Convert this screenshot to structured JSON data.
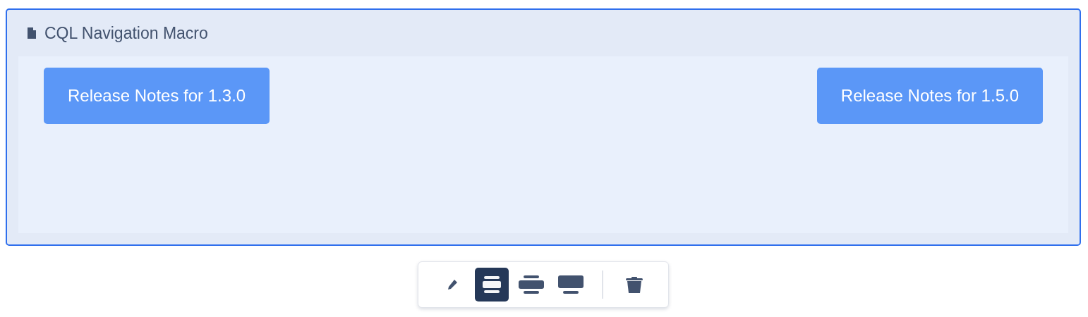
{
  "macro": {
    "title": "CQL Navigation Macro"
  },
  "buttons": [
    {
      "label": "Release Notes for 1.3.0"
    },
    {
      "label": "Release Notes for 1.5.0"
    }
  ],
  "toolbar": [
    {
      "kind": "edit"
    },
    {
      "kind": "narrow",
      "selected": true
    },
    {
      "kind": "wide",
      "selected": false
    },
    {
      "kind": "full",
      "selected": false
    },
    {
      "kind": "divider"
    },
    {
      "kind": "delete"
    }
  ]
}
